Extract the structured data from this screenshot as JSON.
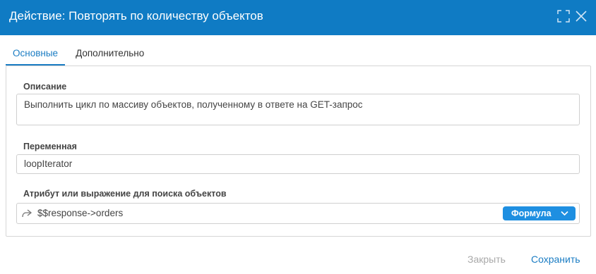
{
  "dialog": {
    "title": "Действие: Повторять по количеству объектов",
    "maximize_icon": "maximize-icon",
    "close_icon": "close-icon"
  },
  "tabs": [
    {
      "label": "Основные",
      "active": true
    },
    {
      "label": "Дополнительно",
      "active": false
    }
  ],
  "fields": {
    "description": {
      "label": "Описание",
      "value": "Выполнить цикл по массиву объектов, полученному в ответе на GET-запрос"
    },
    "variable": {
      "label": "Переменная",
      "value": "loopIterator"
    },
    "attribute": {
      "label": "Атрибут или выражение для поиска объектов",
      "value": "$$response->orders",
      "icon": "share-arrow-icon",
      "mode_label": "Формула"
    }
  },
  "footer": {
    "close_label": "Закрыть",
    "save_label": "Сохранить"
  },
  "colors": {
    "header": "#0f7bc4",
    "accent": "#1a7cc3",
    "formula_badge": "#1e8fe1",
    "disabled_text": "#a9a9a9"
  }
}
